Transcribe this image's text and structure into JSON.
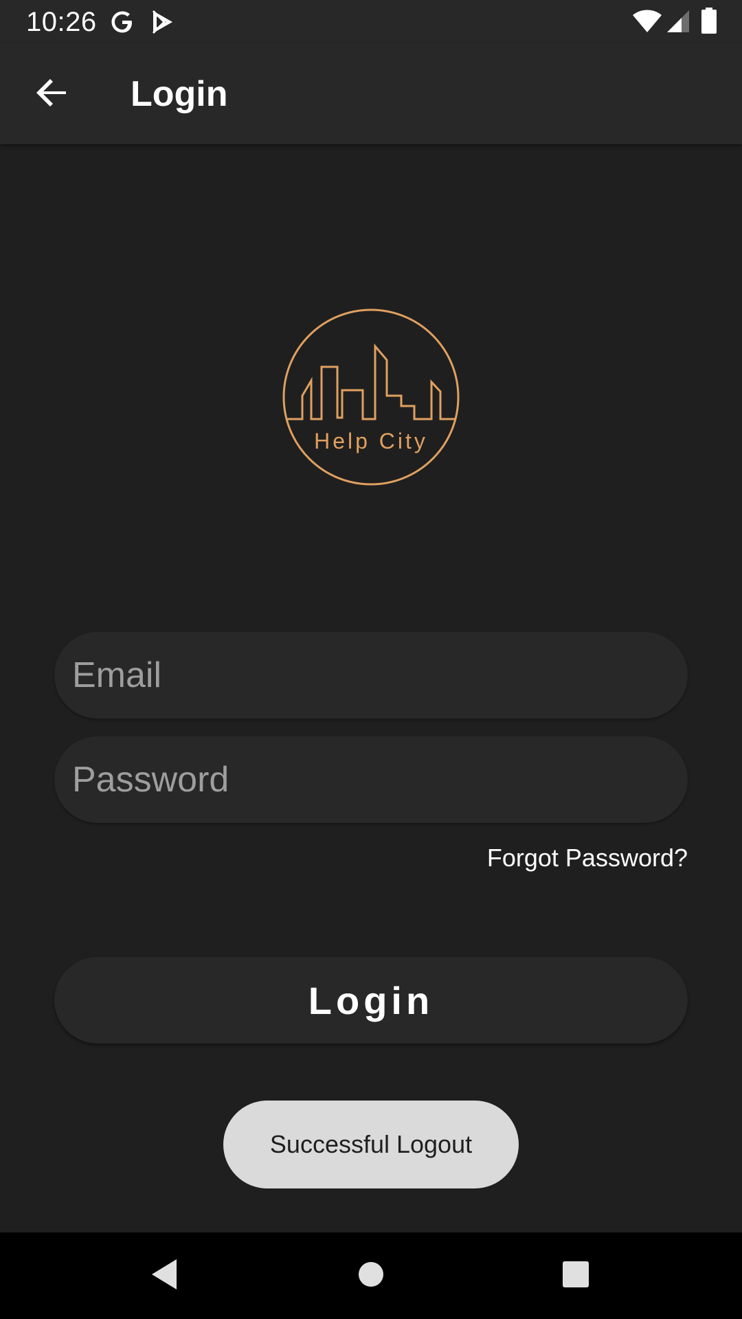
{
  "status_bar": {
    "time": "10:26",
    "icons": [
      "google-icon",
      "play-store-icon",
      "wifi-icon",
      "signal-icon",
      "battery-icon"
    ]
  },
  "app_bar": {
    "title": "Login",
    "back_icon": "arrow-back-icon"
  },
  "logo": {
    "text": "Help City",
    "color": "#e0a060"
  },
  "form": {
    "email_placeholder": "Email",
    "email_value": "",
    "password_placeholder": "Password",
    "password_value": "",
    "forgot_label": "Forgot Password?",
    "login_label": "Login"
  },
  "toast": {
    "message": "Successful Logout"
  },
  "nav_bar": {
    "icons": [
      "back-triangle-icon",
      "home-circle-icon",
      "recents-square-icon"
    ]
  },
  "colors": {
    "background": "#1f1f1f",
    "surface": "#282828",
    "accent": "#e0a060",
    "toast_bg": "#dadada"
  }
}
